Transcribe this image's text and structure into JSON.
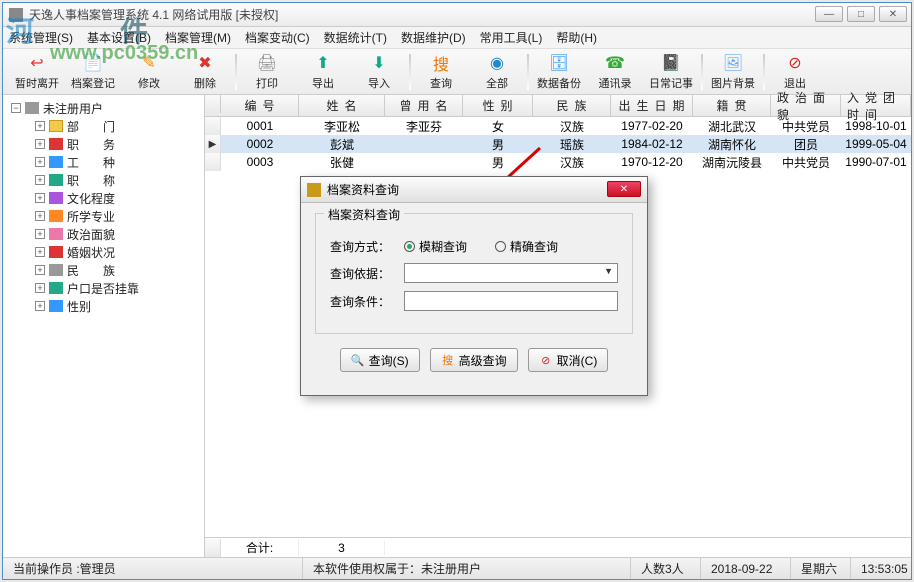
{
  "app": {
    "title": "天逸人事档案管理系统  4.1  网络试用版      [未授权]"
  },
  "watermark": {
    "line1a": "河",
    "line1b": "件",
    "line2": "www.pc0359.cn"
  },
  "menu": [
    "系统管理(S)",
    "基本设置(B)",
    "档案管理(M)",
    "档案变动(C)",
    "数据统计(T)",
    "数据维护(D)",
    "常用工具(L)",
    "帮助(H)"
  ],
  "toolbar": [
    {
      "label": "暂时离开",
      "iconColor": "#e33",
      "glyph": "↩"
    },
    {
      "label": "档案登记",
      "iconColor": "#2a8",
      "glyph": "📄"
    },
    {
      "label": "修改",
      "iconColor": "#f80",
      "glyph": "✎"
    },
    {
      "label": "删除",
      "iconColor": "#d33",
      "glyph": "✖"
    },
    {
      "sep": true
    },
    {
      "label": "打印",
      "iconColor": "#888",
      "glyph": "🖨"
    },
    {
      "label": "导出",
      "iconColor": "#1a8",
      "glyph": "⬆"
    },
    {
      "label": "导入",
      "iconColor": "#1a8",
      "glyph": "⬇"
    },
    {
      "sep": true
    },
    {
      "label": "查询",
      "iconColor": "#e70",
      "glyph": "搜"
    },
    {
      "label": "全部",
      "iconColor": "#28c",
      "glyph": "◉"
    },
    {
      "sep": true
    },
    {
      "label": "数据备份",
      "iconColor": "#39f",
      "glyph": "🗄"
    },
    {
      "label": "通讯录",
      "iconColor": "#3a3",
      "glyph": "☎"
    },
    {
      "label": "日常记事",
      "iconColor": "#f93",
      "glyph": "📓"
    },
    {
      "sep": true
    },
    {
      "label": "图片背景",
      "iconColor": "#6af",
      "glyph": "🖼"
    },
    {
      "sep": true
    },
    {
      "label": "退出",
      "iconColor": "#d22",
      "glyph": "⊘"
    }
  ],
  "tree": {
    "root": "未注册用户",
    "children": [
      {
        "label": "部　　门",
        "cls": "folder"
      },
      {
        "label": "职　　务",
        "cls": "red"
      },
      {
        "label": "工　　种",
        "cls": "blue"
      },
      {
        "label": "职　　称",
        "cls": "green"
      },
      {
        "label": "文化程度",
        "cls": "purple"
      },
      {
        "label": "所学专业",
        "cls": "orange"
      },
      {
        "label": "政治面貌",
        "cls": "pink"
      },
      {
        "label": "婚姻状况",
        "cls": "red"
      },
      {
        "label": "民　　族",
        "cls": "gray"
      },
      {
        "label": "户口是否挂靠",
        "cls": "green"
      },
      {
        "label": "性别",
        "cls": "blue"
      }
    ]
  },
  "grid": {
    "headers": [
      "编号",
      "姓名",
      "曾用名",
      "性别",
      "民族",
      "出生日期",
      "籍贯",
      "政治面貌",
      "入党团时间"
    ],
    "rows": [
      {
        "c": [
          "0001",
          "李亚松",
          "李亚芬",
          "女",
          "汉族",
          "1977-02-20",
          "湖北武汉",
          "中共党员",
          "1998-10-01"
        ],
        "sel": false
      },
      {
        "c": [
          "0002",
          "彭斌",
          "",
          "男",
          "瑶族",
          "1984-02-12",
          "湖南怀化",
          "团员",
          "1999-05-04"
        ],
        "sel": true
      },
      {
        "c": [
          "0003",
          "张健",
          "",
          "男",
          "汉族",
          "1970-12-20",
          "湖南沅陵县",
          "中共党员",
          "1990-07-01"
        ],
        "sel": false
      }
    ],
    "footer": {
      "label": "合计:",
      "count": "3"
    }
  },
  "dialog": {
    "title": "档案资料查询",
    "group": "档案资料查询",
    "mode_label": "查询方式：",
    "mode_fuzzy": "模糊查询",
    "mode_exact": "精确查询",
    "basis_label": "查询依据：",
    "cond_label": "查询条件：",
    "btn_search": "查询(S)",
    "btn_adv": "高级查询",
    "btn_cancel": "取消(C)"
  },
  "status": {
    "operator_label": "当前操作员 : ",
    "operator": "管理员",
    "license": "本软件使用权属于：未注册用户",
    "count": "人数3人",
    "date": "2018-09-22",
    "weekday": "星期六",
    "time": "13:53:05"
  }
}
